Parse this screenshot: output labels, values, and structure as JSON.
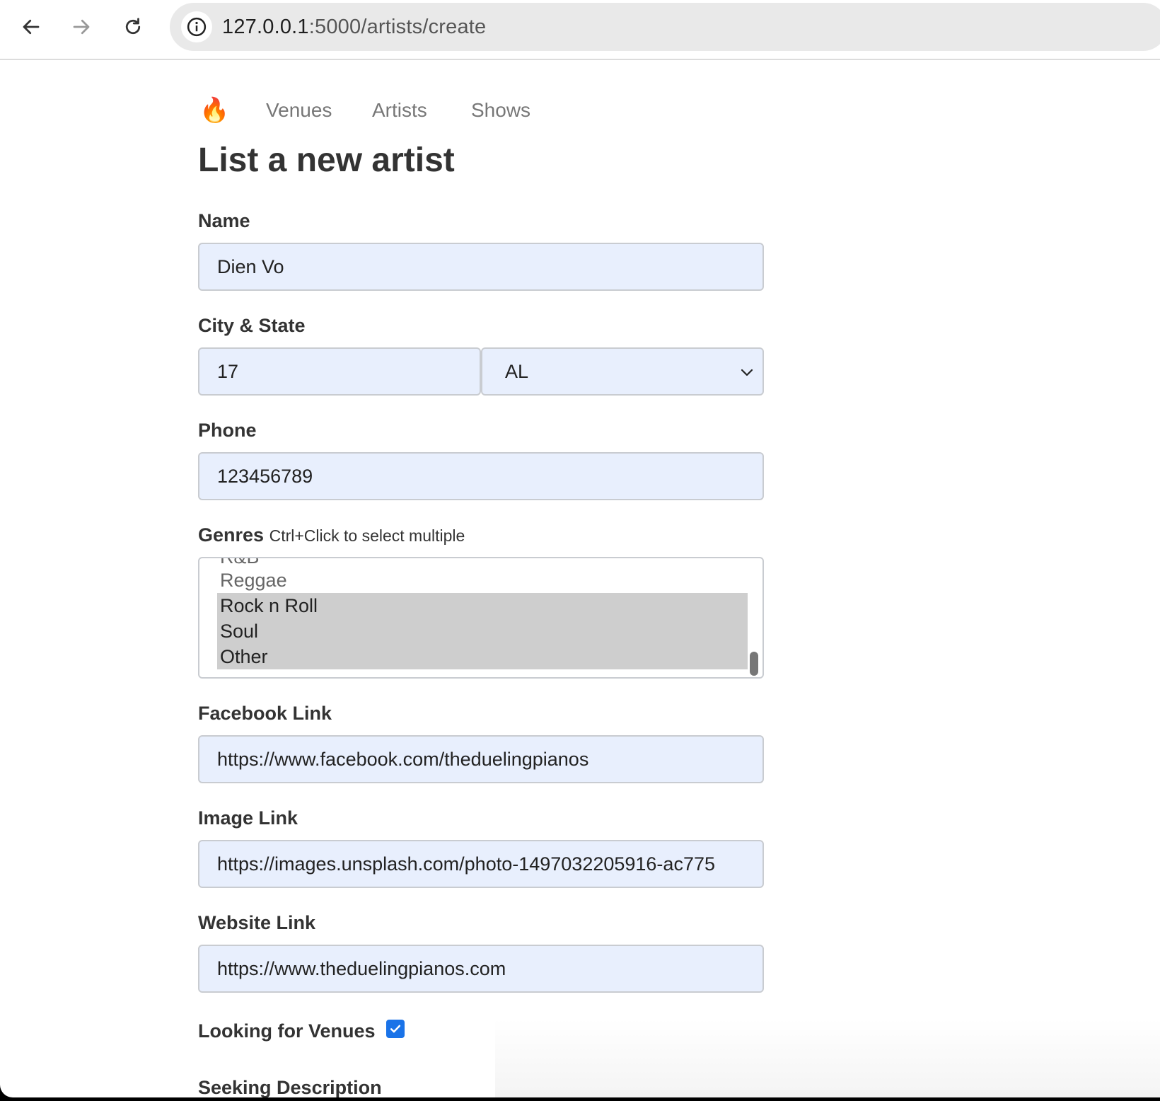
{
  "browser": {
    "back_icon": "arrow-left-icon",
    "forward_icon": "arrow-right-icon",
    "reload_icon": "reload-icon",
    "site_info_icon": "info-icon",
    "url_host": "127.0.0.1",
    "url_path": ":5000/artists/create"
  },
  "nav": {
    "brand": "🔥",
    "links": [
      "Venues",
      "Artists",
      "Shows"
    ]
  },
  "form": {
    "title": "List a new artist",
    "name_label": "Name",
    "name_value": "Dien Vo",
    "city_state_label": "City & State",
    "city_value": "17",
    "state_value": "AL",
    "phone_label": "Phone",
    "phone_value": "123456789",
    "genres_label": "Genres",
    "genres_hint": "Ctrl+Click to select multiple",
    "genres_visible_options": [
      {
        "label": "R&B",
        "selected": false
      },
      {
        "label": "Reggae",
        "selected": false
      },
      {
        "label": "Rock n Roll",
        "selected": true
      },
      {
        "label": "Soul",
        "selected": true
      },
      {
        "label": "Other",
        "selected": true
      }
    ],
    "facebook_label": "Facebook Link",
    "facebook_value": "https://www.facebook.com/theduelingpianos",
    "image_label": "Image Link",
    "image_value": "https://images.unsplash.com/photo-1497032205916-ac775",
    "website_label": "Website Link",
    "website_value": "https://www.theduelingpianos.com",
    "looking_label": "Looking for Venues",
    "looking_checked": true,
    "seeking_label": "Seeking Description"
  }
}
